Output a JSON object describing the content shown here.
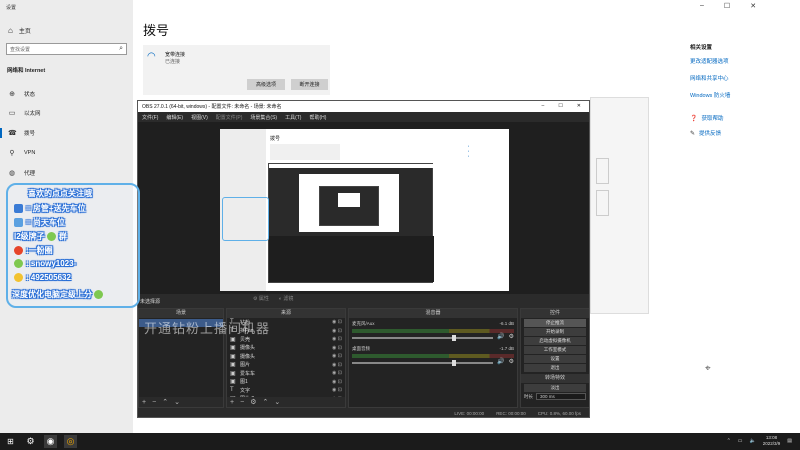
{
  "settings": {
    "window_title": "设置",
    "home": "主页",
    "search_placeholder": "查找设置",
    "section": "网络和 Internet",
    "nav": [
      {
        "icon": "status-icon",
        "label": "状态"
      },
      {
        "icon": "ethernet-icon",
        "label": "以太网"
      },
      {
        "icon": "dialup-icon",
        "label": "拨号"
      },
      {
        "icon": "vpn-icon",
        "label": "VPN"
      },
      {
        "icon": "proxy-icon",
        "label": "代理"
      }
    ],
    "page_title": "拨号",
    "connection_name": "宽带连接",
    "connection_status": "已连接",
    "btn_advanced": "高级选项",
    "btn_disconnect": "断开连接",
    "related_title": "相关设置",
    "related_links": [
      "更改适配器选项",
      "网络和共享中心",
      "Windows 防火墙"
    ],
    "help_links": [
      "获取帮助",
      "提供反馈"
    ]
  },
  "obs": {
    "title": "OBS 27.0.1 (64-bit, windows) - 配置文件: 未命名 - 场景: 未命名",
    "menu": [
      "文件(F)",
      "编辑(E)",
      "视图(V)",
      "配置文件(P)",
      "场景集合(S)",
      "工具(T)",
      "帮助(H)"
    ],
    "scenes_header": "场景",
    "sources_header": "来源",
    "mixer_header": "混音器",
    "controls_header": "控件",
    "transitions_header": "转场特效",
    "scene_label": "未选择源",
    "toolbar_props": "属性",
    "toolbar_filters": "滤镜",
    "sources": [
      {
        "icon": "text-icon",
        "label": "钻粉"
      },
      {
        "icon": "text-icon",
        "label": "抖Fan"
      },
      {
        "icon": "image-icon",
        "label": "贝壳"
      },
      {
        "icon": "image-icon",
        "label": "摄像头"
      },
      {
        "icon": "image-icon",
        "label": "摄像头"
      },
      {
        "icon": "image-icon",
        "label": "图片"
      },
      {
        "icon": "image-icon",
        "label": "爱车车"
      },
      {
        "icon": "image-icon",
        "label": "图1"
      },
      {
        "icon": "text-icon",
        "label": "文字"
      },
      {
        "icon": "image-icon",
        "label": "图片 2"
      }
    ],
    "mixer_channels": [
      {
        "name": "麦克风/Aux",
        "db": "-6.1 dB"
      },
      {
        "name": "桌面音频",
        "db": "-1.7 dB"
      }
    ],
    "controls": [
      "停止推流",
      "开始录制",
      "启动虚拟摄像机",
      "工作室模式",
      "设置",
      "退出"
    ],
    "transition_name": "淡出",
    "duration_label": "时长",
    "duration_value": "300 ms",
    "status": [
      "LIVE: 00:00:00",
      "REC: 00:00:00",
      "CPU: 0.8%, 60.00 fps"
    ]
  },
  "overlay": {
    "lines": [
      "喜欢的点点关注哦",
      "= 房管+送先车位",
      "= 尚天车位",
      "l2级牌子",
      "群",
      ":一粉圈",
      ": snowy1023-",
      ": 492505632",
      "深度优化电脑定级上分"
    ]
  },
  "watermark": "开通钻粉上播间机器",
  "taskbar": {
    "time": "13:08",
    "date": "2022/3/9"
  },
  "colors": {
    "accent": "#0067c0",
    "obs_bg": "#2b2b2b",
    "overlay_border": "#5fb0e8",
    "overlay_text_stroke": "#2a6fd6"
  }
}
